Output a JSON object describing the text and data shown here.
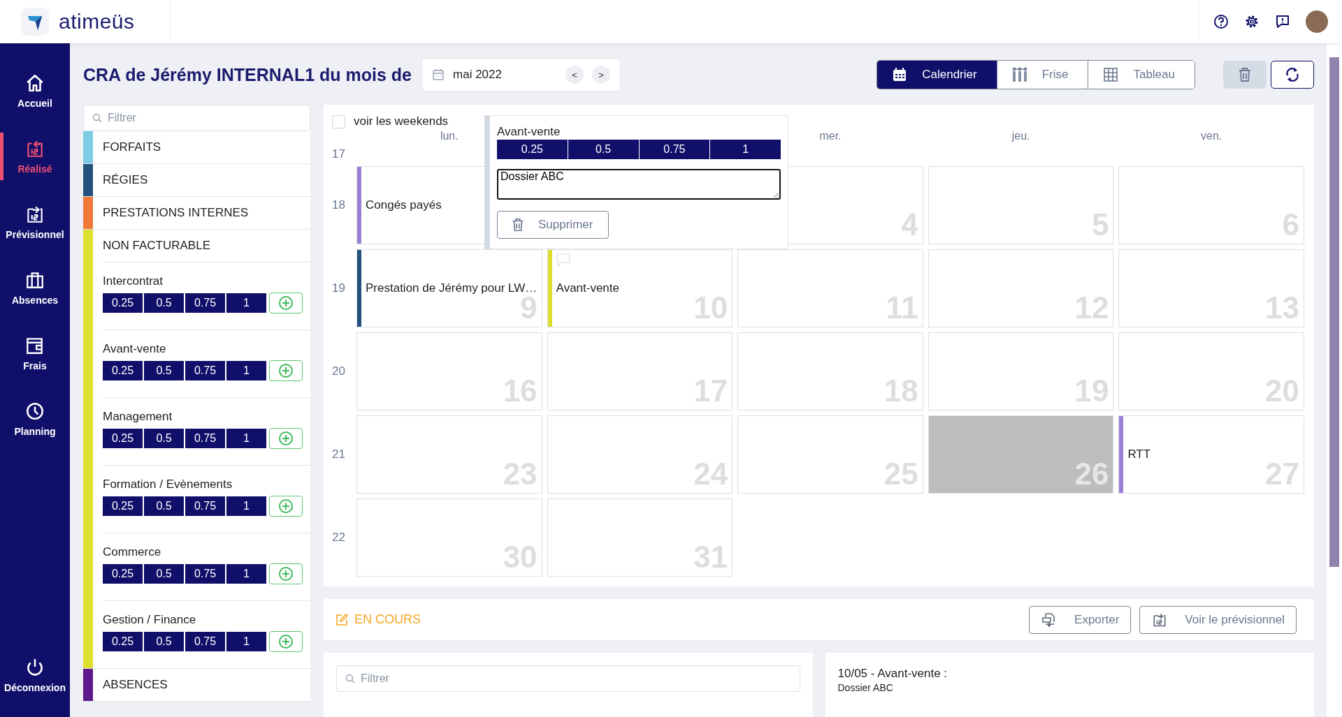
{
  "header": {
    "logo_text": "atimeüs"
  },
  "nav": [
    {
      "label": "Accueil",
      "selected": false
    },
    {
      "label": "Réalisé",
      "selected": true
    },
    {
      "label": "Prévisionnel",
      "selected": false
    },
    {
      "label": "Absences",
      "selected": false
    },
    {
      "label": "Frais",
      "selected": false
    },
    {
      "label": "Planning",
      "selected": false
    }
  ],
  "logout": {
    "label": "Déconnexion"
  },
  "title": "CRA de Jérémy INTERNAL1 du mois de",
  "month_picker": {
    "value": "mai 2022",
    "prev": "<",
    "next": ">"
  },
  "views": [
    {
      "label": "Calendrier",
      "selected": true
    },
    {
      "label": "Frise",
      "selected": false
    },
    {
      "label": "Tableau",
      "selected": false
    }
  ],
  "activities": {
    "filter_placeholder": "Filtrer",
    "categories": [
      {
        "label": "FORFAITS",
        "color": "#7ecbe6"
      },
      {
        "label": "RÉGIES",
        "color": "#24507e"
      },
      {
        "label": "PRESTATIONS INTERNES",
        "color": "#f07838"
      },
      {
        "label": "NON FACTURABLE",
        "color": "#dede2c",
        "children": [
          {
            "label": "Intercontrat",
            "options": [
              "0.25",
              "0.5",
              "0.75",
              "1"
            ]
          },
          {
            "label": "Avant-vente",
            "options": [
              "0.25",
              "0.5",
              "0.75",
              "1"
            ]
          },
          {
            "label": "Management",
            "options": [
              "0.25",
              "0.5",
              "0.75",
              "1"
            ]
          },
          {
            "label": "Formation / Evènements",
            "options": [
              "0.25",
              "0.5",
              "0.75",
              "1"
            ]
          },
          {
            "label": "Commerce",
            "options": [
              "0.25",
              "0.5",
              "0.75",
              "1"
            ]
          },
          {
            "label": "Gestion / Finance",
            "options": [
              "0.25",
              "0.5",
              "0.75",
              "1"
            ]
          }
        ]
      },
      {
        "label": "ABSENCES",
        "color": "#5e1a8a"
      }
    ]
  },
  "calendar": {
    "weekends": {
      "label": "voir les weekends",
      "checked": false
    },
    "day_headers": [
      {
        "label": "lun.",
        "kind": "mon"
      },
      {
        "label": "mer.",
        "kind": "wed"
      },
      {
        "label": "jeu.",
        "kind": "thu"
      },
      {
        "label": "ven.",
        "kind": "fri"
      }
    ],
    "weeks": [
      {
        "number": "17"
      },
      {
        "number": "18",
        "days": [
          {
            "kind": "mon",
            "holiday": false,
            "event": {
              "label": "Congés payés",
              "color": "#9b7fd4",
              "comment": false
            }
          },
          {
            "kind": "wed",
            "number": "4",
            "holiday": false
          },
          {
            "kind": "thu",
            "number": "5",
            "holiday": false
          },
          {
            "kind": "fri",
            "number": "6",
            "holiday": false
          }
        ]
      },
      {
        "number": "19",
        "days": [
          {
            "kind": "mon",
            "number": "9",
            "holiday": false,
            "event": {
              "label": "Prestation de Jérémy pour LW…",
              "color": "#24507e",
              "comment": false
            }
          },
          {
            "kind": "tue",
            "number": "10",
            "holiday": false,
            "event": {
              "label": "Avant-vente",
              "color": "#dede2c",
              "comment": true
            }
          },
          {
            "kind": "wed",
            "number": "11",
            "holiday": false
          },
          {
            "kind": "thu",
            "number": "12",
            "holiday": false
          },
          {
            "kind": "fri",
            "number": "13",
            "holiday": false
          }
        ]
      },
      {
        "number": "20",
        "days": [
          {
            "kind": "mon",
            "number": "16",
            "holiday": false
          },
          {
            "kind": "tue",
            "number": "17",
            "holiday": false
          },
          {
            "kind": "wed",
            "number": "18",
            "holiday": false
          },
          {
            "kind": "thu",
            "number": "19",
            "holiday": false
          },
          {
            "kind": "fri",
            "number": "20",
            "holiday": false
          }
        ]
      },
      {
        "number": "21",
        "days": [
          {
            "kind": "mon",
            "number": "23",
            "holiday": false
          },
          {
            "kind": "tue",
            "number": "24",
            "holiday": false
          },
          {
            "kind": "wed",
            "number": "25",
            "holiday": false
          },
          {
            "kind": "thu",
            "number": "26",
            "holiday": true
          },
          {
            "kind": "fri",
            "number": "27",
            "holiday": false,
            "event": {
              "label": "RTT",
              "color": "#9b7fd4",
              "comment": false
            }
          }
        ]
      },
      {
        "number": "22",
        "days": [
          {
            "kind": "mon",
            "number": "30",
            "holiday": false
          },
          {
            "kind": "tue",
            "number": "31",
            "holiday": false
          }
        ]
      }
    ],
    "popup": {
      "activity": "Avant-vente",
      "options": [
        "0.25",
        "0.5",
        "0.75",
        "1"
      ],
      "comment": "Dossier ABC",
      "delete_label": "Supprimer"
    }
  },
  "status": {
    "label": "EN COURS",
    "export": "Exporter",
    "forecast": "Voir le prévisionnel"
  },
  "list_filter_placeholder": "Filtrer",
  "comments": [
    {
      "title": "10/05 - Avant-vente :",
      "text": "Dossier ABC"
    }
  ]
}
